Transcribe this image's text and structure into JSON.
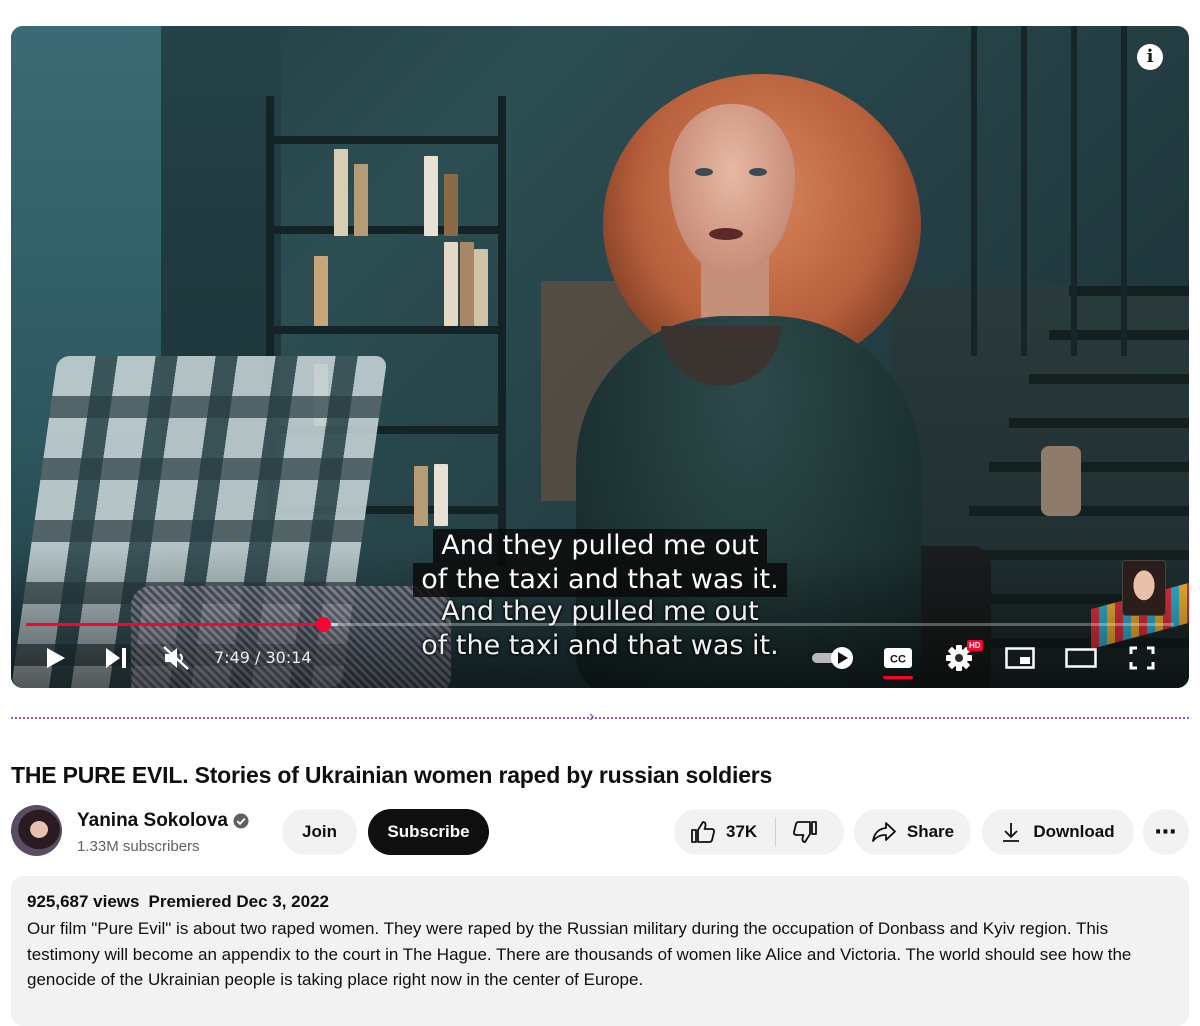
{
  "player": {
    "captions": {
      "line1": "And they pulled me out",
      "line2": "of the taxi and that was it."
    },
    "captions_duplicate": {
      "line1": "And they pulled me out",
      "line2": "of the taxi and that was it."
    },
    "time_display": "7:49 / 30:14",
    "progress_fraction": 0.259,
    "buffered_fraction": 0.272,
    "settings_badge": "HD",
    "captions_enabled": true,
    "muted": true
  },
  "video": {
    "title": "THE PURE EVIL. Stories of Ukrainian women raped by russian soldiers"
  },
  "channel": {
    "name": "Yanina Sokolova",
    "subscribers": "1.33M subscribers",
    "verified": true
  },
  "actions": {
    "join_label": "Join",
    "subscribe_label": "Subscribe",
    "like_count": "37K",
    "share_label": "Share",
    "download_label": "Download",
    "more_label": "⋯"
  },
  "description": {
    "views": "925,687 views",
    "premiered": "Premiered Dec 3, 2022",
    "text": "Our film \"Pure Evil\" is about two raped women. They were raped by the Russian military during the occupation of Donbass and Kyiv region. This testimony will become an appendix to the court in The Hague. There are thousands of women like Alice and Victoria. The world should see how the genocide of the Ukrainian people is taking place right now in the center of Europe."
  },
  "colors": {
    "progress_played": "#ff0033",
    "subscribe_bg": "#0f0f0f",
    "pill_bg": "#f2f2f2",
    "divider": "#8e57c9"
  }
}
